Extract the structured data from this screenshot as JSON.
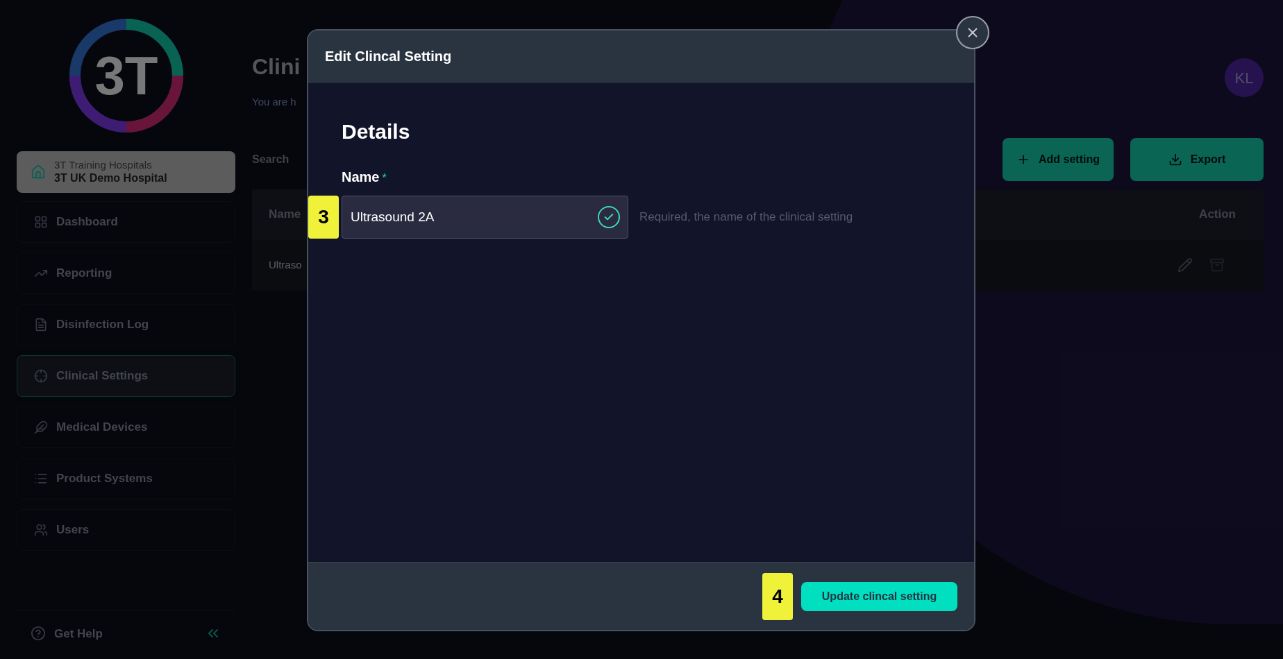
{
  "logo": {
    "text": "3T"
  },
  "hospital": {
    "group": "3T Training Hospitals",
    "name": "3T UK Demo Hospital"
  },
  "nav": [
    {
      "label": "Dashboard",
      "kind": "grid",
      "selected": false
    },
    {
      "label": "Reporting",
      "kind": "trend",
      "selected": false
    },
    {
      "label": "Disinfection Log",
      "kind": "file",
      "selected": false
    },
    {
      "label": "Clinical Settings",
      "kind": "target",
      "selected": true
    },
    {
      "label": "Medical Devices",
      "kind": "feather",
      "selected": false
    },
    {
      "label": "Product Systems",
      "kind": "list",
      "selected": false
    },
    {
      "label": "Users",
      "kind": "users",
      "selected": false
    }
  ],
  "help": {
    "label": "Get Help"
  },
  "page": {
    "title": "Clini",
    "subtitle": "You are h",
    "search_label": "Search",
    "add_button": "Add setting",
    "export_button": "Export",
    "avatar": "KL",
    "table": {
      "columns": [
        "Name",
        "Action"
      ],
      "rows": [
        {
          "name": "Ultraso"
        }
      ]
    }
  },
  "modal": {
    "title": "Edit Clincal Setting",
    "section": "Details",
    "field": {
      "label": "Name",
      "required_mark": "*",
      "value": "Ultrasound 2A",
      "valid": true,
      "hint": "Required, the name of the clinical setting"
    },
    "submit": "Update clincal setting"
  },
  "markers": [
    "3",
    "4"
  ]
}
